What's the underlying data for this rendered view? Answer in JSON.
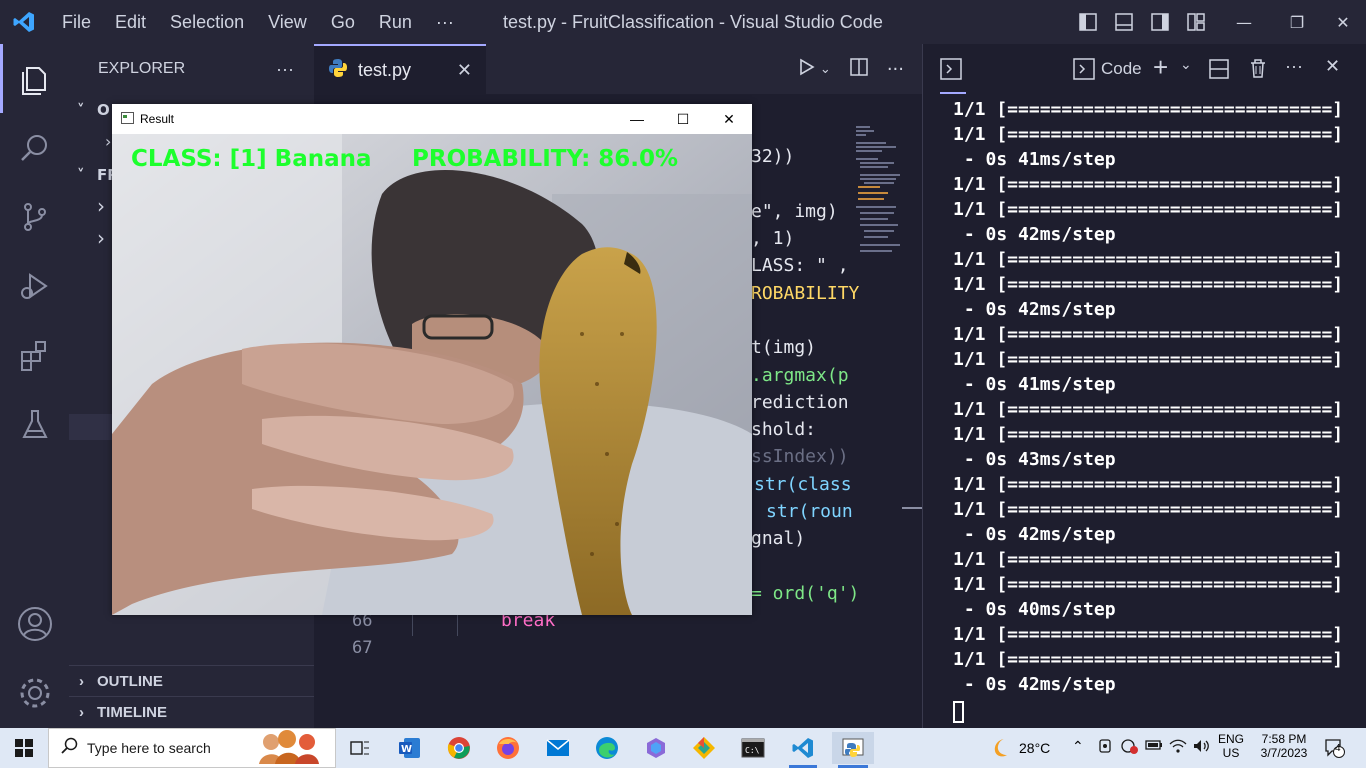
{
  "window": {
    "title": "test.py - FruitClassification - Visual Studio Code",
    "menu": [
      "File",
      "Edit",
      "Selection",
      "View",
      "Go",
      "Run",
      "···"
    ]
  },
  "sidebar": {
    "header": "EXPLORER",
    "more": "···",
    "sections": [
      {
        "label": "O",
        "chevron": "˅"
      },
      {
        "label": "FR",
        "chevron": "˅"
      }
    ],
    "outline_label": "OUTLINE",
    "timeline_label": "TIMELINE"
  },
  "editor": {
    "tab_label": "test.py",
    "tab_close": "✕",
    "visible_fragments": [
      {
        "text": "32))",
        "color": "#e6e8f0"
      },
      {
        "text": "e\", img)",
        "color": "#e6e8f0"
      },
      {
        "text": ", 1)",
        "color": "#e6e8f0"
      },
      {
        "text": "LASS: \" ,",
        "color": "#e6e8f0"
      },
      {
        "text": "ROBABILITY",
        "color": "#e6e8f0"
      },
      {
        "text": "t(img)",
        "color": "#e6e8f0"
      },
      {
        "text": ".argmax(p",
        "color": "#e6e8f0"
      },
      {
        "text": "rediction",
        "color": "#e6e8f0"
      },
      {
        "text": "shold:",
        "color": "#e6e8f0"
      },
      {
        "text": "ssIndex))",
        "color": "#6b6f85"
      },
      {
        "text": "str(class",
        "color": "#e6e8f0"
      },
      {
        "text": "str(roun",
        "color": "#e6e8f0"
      },
      {
        "text": "gnal)",
        "color": "#e6e8f0"
      },
      {
        "text": "= ord('q')",
        "color": "#e6e8f0"
      }
    ],
    "line_numbers": [
      "66",
      "67"
    ],
    "line_66_code": "break"
  },
  "panel": {
    "code_label": "Code",
    "terminal_lines": [
      "1/1 [==============================]",
      "1/1 [==============================]",
      " - 0s 41ms/step",
      "1/1 [==============================]",
      "1/1 [==============================]",
      " - 0s 42ms/step",
      "1/1 [==============================]",
      "1/1 [==============================]",
      " - 0s 42ms/step",
      "1/1 [==============================]",
      "1/1 [==============================]",
      " - 0s 41ms/step",
      "1/1 [==============================]",
      "1/1 [==============================]",
      " - 0s 43ms/step",
      "1/1 [==============================]",
      "1/1 [==============================]",
      " - 0s 42ms/step",
      "1/1 [==============================]",
      "1/1 [==============================]",
      " - 0s 40ms/step",
      "1/1 [==============================]",
      "1/1 [==============================]",
      " - 0s 42ms/step"
    ]
  },
  "result_window": {
    "title": "Result",
    "class_text": "CLASS:  [1] Banana",
    "probability_text": "PROBABILITY: 86.0%",
    "text_color": "#1dff2d"
  },
  "taskbar": {
    "search_placeholder": "Type here to search",
    "weather": "28°C",
    "language": "ENG",
    "region": "US",
    "time": "7:58 PM",
    "date": "3/7/2023",
    "notifications": "4"
  },
  "colors": {
    "accent": "#a4a9ff",
    "editor_bg": "#1e1e2e",
    "sidebar_bg": "#262637"
  }
}
